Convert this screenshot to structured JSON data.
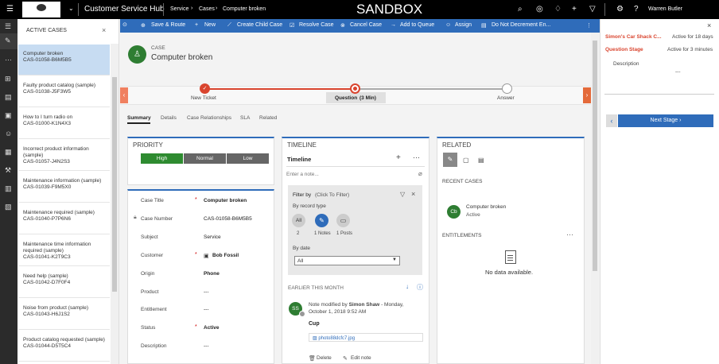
{
  "topbar": {
    "app_title": "Customer Service Hub",
    "breadcrumb": [
      "Service",
      "Cases",
      "Computer broken"
    ],
    "environment": "SANDBOX",
    "user": "Warren Butler"
  },
  "sidebar": {
    "title": "ACTIVE CASES",
    "items": [
      {
        "title": "Computer broken",
        "id": "CAS-01058-B6M5B5"
      },
      {
        "title": "Faulty product catalog (sample)",
        "id": "CAS-01038-J5F3W5"
      },
      {
        "title": "How to I turn radio on",
        "id": "CAS-01000-K1N4X3"
      },
      {
        "title": "Incorrect product information (sample)",
        "id": "CAS-01057-J4N2S3"
      },
      {
        "title": "Maintenance information (sample)",
        "id": "CAS-01039-F9M5X0"
      },
      {
        "title": "Maintenance required (sample)",
        "id": "CAS-01040-P7P6N6"
      },
      {
        "title": "Maintenance time information required (sample)",
        "id": "CAS-01041-K2T9C3"
      },
      {
        "title": "Need help (sample)",
        "id": "CAS-01042-D7F0F4"
      },
      {
        "title": "Noise from product (sample)",
        "id": "CAS-01043-H6J1S2"
      },
      {
        "title": "Product catalog requested (sample)",
        "id": "CAS-01044-D5T5C4"
      }
    ]
  },
  "commands": [
    "Save & Route",
    "New",
    "Create Child Case",
    "Resolve Case",
    "Cancel Case",
    "Add to Queue",
    "Assign",
    "Do Not Decrement En..."
  ],
  "header": {
    "entity": "CASE",
    "title": "Computer broken"
  },
  "stages": [
    {
      "label": "New Ticket"
    },
    {
      "label": "Question",
      "duration": "(3 Min)"
    },
    {
      "label": "Answer"
    }
  ],
  "tabs": [
    "Summary",
    "Details",
    "Case Relationships",
    "SLA",
    "Related"
  ],
  "priority": {
    "title": "PRIORITY",
    "options": [
      "High",
      "Normal",
      "Low"
    ]
  },
  "fields": [
    {
      "label": "Case Title",
      "required": "*",
      "value": "Computer broken"
    },
    {
      "label": "Case Number",
      "value": "CAS-01058-B6M5B5"
    },
    {
      "label": "Subject",
      "value": "Service"
    },
    {
      "label": "Customer",
      "required": "*",
      "value": "Bob Fossil"
    },
    {
      "label": "Origin",
      "value": "Phone"
    },
    {
      "label": "Product",
      "value": "---"
    },
    {
      "label": "Entitlement",
      "value": "---"
    },
    {
      "label": "Status",
      "required": "*",
      "value": "Active"
    },
    {
      "label": "Description",
      "value": "---"
    }
  ],
  "timeline": {
    "title": "TIMELINE",
    "subtitle": "Timeline",
    "note_placeholder": "Enter a note...",
    "filter_by": "Filter by",
    "filter_hint": "(Click To Filter)",
    "by_record_type": "By record type",
    "types": [
      {
        "icon": "All",
        "count": "2"
      },
      {
        "count": "1 Notes"
      },
      {
        "count": "1 Posts"
      }
    ],
    "by_date": "By date",
    "date_value": "All",
    "earlier": "EARLIER THIS MONTH",
    "entry": {
      "initials": "SS",
      "prefix": "Note modified by",
      "author": "Simon Shaw",
      "suffix": "- Monday,",
      "date": "October 1, 2018 9:52 AM",
      "title": "Cup",
      "attachment": "photo88dcfc7.jpg",
      "delete": "Delete",
      "edit": "Edit note"
    }
  },
  "related": {
    "title": "RELATED",
    "recent_cases": "RECENT CASES",
    "recent": {
      "initials": "Cb",
      "title": "Computer broken",
      "status": "Active"
    },
    "entitlements": "ENTITLEMENTS",
    "no_data": "No data available."
  },
  "stagepanel": {
    "account": "Simon's Car Shack C...",
    "account_status": "Active for 18 days",
    "stage": "Question Stage",
    "stage_status": "Active for 3 minutes",
    "description_label": "Description",
    "description_value": "---",
    "next": "Next Stage"
  },
  "colors": {
    "accent": "#2f6cba",
    "stage": "#d9442e",
    "priority": "#2e8b30",
    "avatar": "#2e7d32"
  }
}
